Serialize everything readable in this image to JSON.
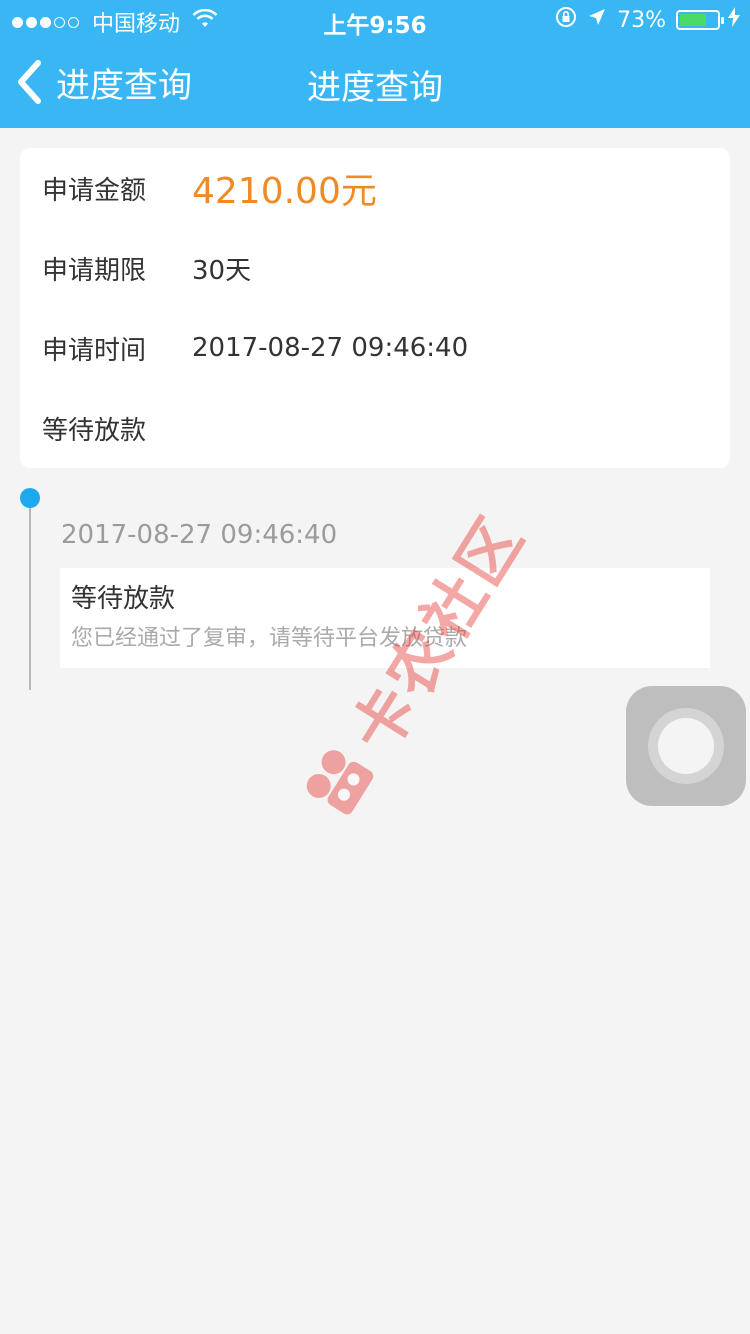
{
  "status_bar": {
    "carrier": "中国移动",
    "time": "上午9:56",
    "battery": "73%",
    "battery_level": 0.73
  },
  "nav": {
    "back_label": "进度查询",
    "title": "进度查询"
  },
  "application": {
    "amount_label": "申请金额",
    "amount_value": "4210.00元",
    "term_label": "申请期限",
    "term_value": "30天",
    "time_label": "申请时间",
    "time_value": "2017-08-27 09:46:40",
    "status": "等待放款"
  },
  "timeline": [
    {
      "time": "2017-08-27 09:46:40",
      "title": "等待放款",
      "description": "您已经通过了复审，请等待平台发放贷款"
    }
  ],
  "watermark": {
    "text": "卡农社区"
  },
  "colors": {
    "header": "#39b7f5",
    "amount": "#ef8a24",
    "timeline_dot": "#1da9ee",
    "background": "#f4f4f4"
  }
}
